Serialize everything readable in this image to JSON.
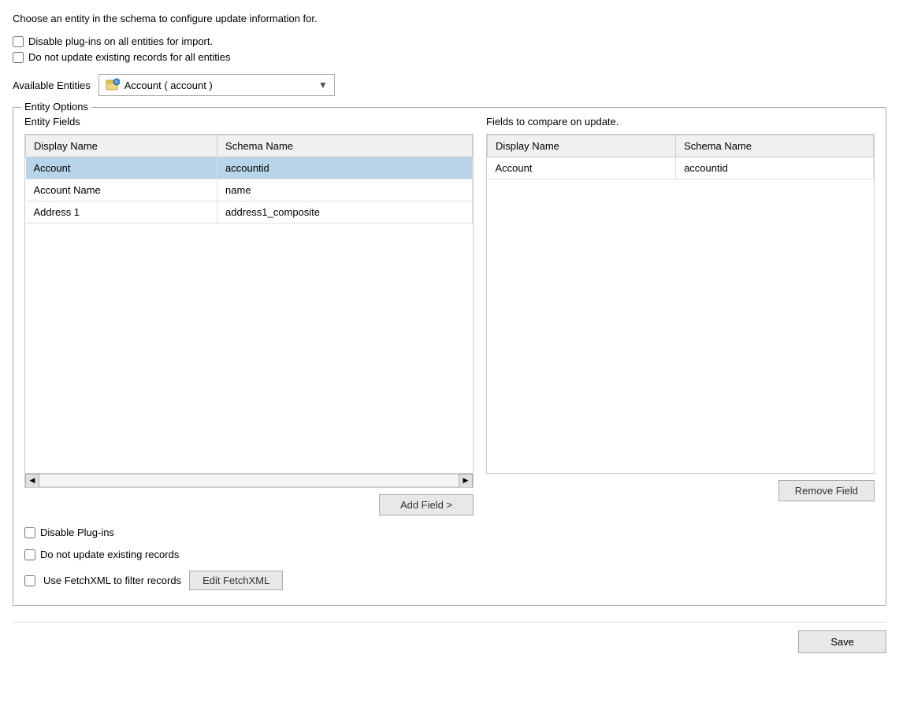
{
  "intro": {
    "text": "Choose an entity in the schema to configure update information for."
  },
  "global_options": {
    "disable_plugins_label": "Disable plug-ins on all entities for import.",
    "no_update_label": "Do not update existing records for all entities"
  },
  "entity_selector": {
    "label": "Available Entities",
    "selected": "Account  (  account  )"
  },
  "entity_options": {
    "legend": "Entity Options",
    "left_title": "Entity Fields",
    "right_title": "Fields to compare on update.",
    "left_columns": [
      "Display Name",
      "Schema Name"
    ],
    "right_columns": [
      "Display Name",
      "Schema Name"
    ],
    "left_rows": [
      {
        "display": "Account",
        "schema": "accountid",
        "selected": true
      },
      {
        "display": "Account Name",
        "schema": "name",
        "selected": false
      },
      {
        "display": "Address 1",
        "schema": "address1_composite",
        "selected": false
      }
    ],
    "right_rows": [
      {
        "display": "Account",
        "schema": "accountid"
      }
    ],
    "add_field_btn": "Add Field >",
    "remove_field_btn": "Remove Field"
  },
  "entity_checkboxes": {
    "disable_plugins_label": "Disable Plug-ins",
    "no_update_label": "Do not update existing records",
    "fetchxml_label": "Use FetchXML to filter records",
    "edit_fetchxml_btn": "Edit FetchXML"
  },
  "save_bar": {
    "save_btn": "Save"
  }
}
